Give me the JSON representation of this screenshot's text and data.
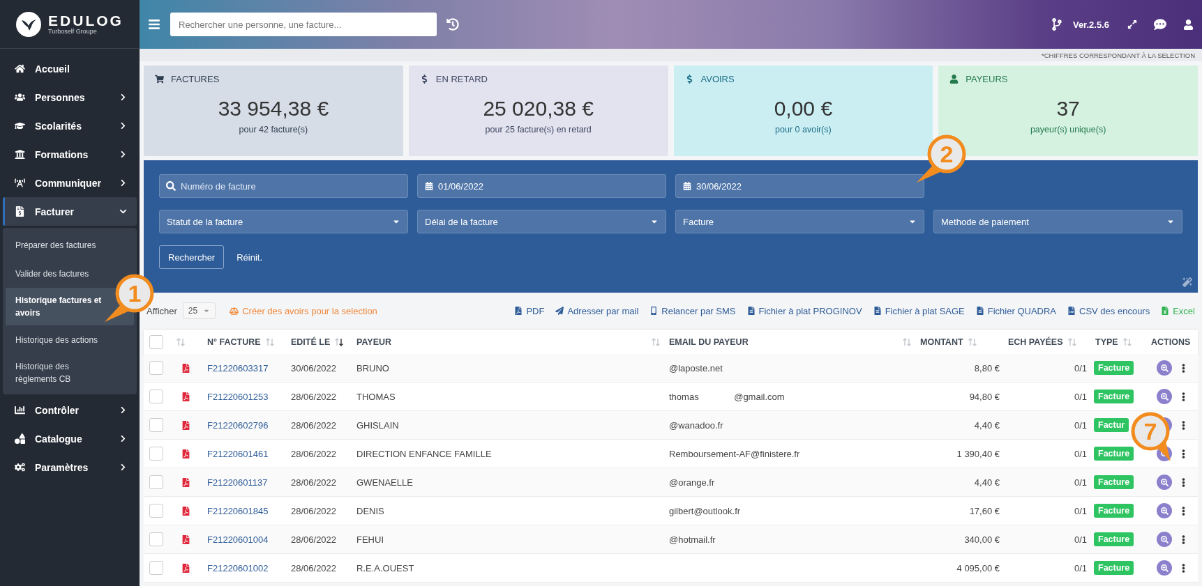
{
  "brand": {
    "name": "EDULOG",
    "tagline": "Turboself Groupe"
  },
  "sidebar": {
    "items": [
      {
        "label": "Accueil"
      },
      {
        "label": "Personnes",
        "expanded": false
      },
      {
        "label": "Scolarités",
        "expanded": false
      },
      {
        "label": "Formations",
        "expanded": false
      },
      {
        "label": "Communiquer",
        "expanded": false
      },
      {
        "label": "Facturer",
        "expanded": true,
        "children": [
          {
            "label": "Préparer des factures",
            "selected": false
          },
          {
            "label": "Valider des factures",
            "selected": false
          },
          {
            "label": "Historique factures et avoirs",
            "selected": true
          },
          {
            "label": "Historique des actions",
            "selected": false
          },
          {
            "label": "Historique des règlements CB",
            "selected": false
          }
        ]
      },
      {
        "label": "Contrôler",
        "expanded": false
      },
      {
        "label": "Catalogue",
        "expanded": false
      },
      {
        "label": "Paramètres",
        "expanded": false
      }
    ]
  },
  "header": {
    "search": {
      "placeholder": "Rechercher une personne, une facture..."
    },
    "version": "Ver.2.5.6"
  },
  "note": "*CHIFFRES CORRESPONDANT À LA SELECTION",
  "stats": [
    {
      "kind": "invoices",
      "title": "FACTURES",
      "value": "33 954,38 €",
      "caption": "pour 42 facture(s)"
    },
    {
      "kind": "late",
      "title": "EN RETARD",
      "value": "25 020,38 €",
      "caption": "pour 25 facture(s) en retard"
    },
    {
      "kind": "credits",
      "title": "AVOIRS",
      "value": "0,00 €",
      "caption": "pour 0 avoir(s)"
    },
    {
      "kind": "payers",
      "title": "PAYEURS",
      "value": "37",
      "caption": "payeur(s) unique(s)"
    }
  ],
  "filters": {
    "fields": [
      {
        "kind": "search",
        "placeholder": "Numéro de facture"
      },
      {
        "kind": "date",
        "value": "01/06/2022"
      },
      {
        "kind": "date",
        "value": "30/06/2022"
      },
      {
        "kind": "select",
        "value": "Statut de la facture"
      },
      {
        "kind": "select",
        "value": "Délai de la facture"
      },
      {
        "kind": "select",
        "value": "Facture"
      },
      {
        "kind": "select",
        "value": "Methode de paiement"
      }
    ],
    "search_button": "Rechercher",
    "reset_button": "Réinit."
  },
  "toolbar": {
    "page_size_label": "Afficher",
    "page_size": "25",
    "create_credits": "Créer des avoirs pour la selection",
    "exports": [
      {
        "kind": "pdf",
        "label": "PDF"
      },
      {
        "kind": "mail",
        "label": "Adresser par mail"
      },
      {
        "kind": "sms",
        "label": "Relancer par SMS"
      },
      {
        "kind": "file",
        "label": "Fichier à plat PROGINOV"
      },
      {
        "kind": "file",
        "label": "Fichier à plat SAGE"
      },
      {
        "kind": "file",
        "label": "Fichier QUADRA"
      },
      {
        "kind": "csv",
        "label": "CSV des encours"
      },
      {
        "kind": "excel",
        "label": "Excel"
      }
    ]
  },
  "table": {
    "select_all": {
      "checked": false
    },
    "columns": [
      {
        "kind": "check"
      },
      {
        "kind": "icon",
        "sortable": true,
        "sorted_desc": false
      },
      {
        "kind": "text",
        "label": "N° FACTURE",
        "sortable": true,
        "sorted_desc": false
      },
      {
        "kind": "text",
        "label": "EDITÉ LE",
        "sortable": true,
        "sorted_desc": true
      },
      {
        "kind": "text",
        "label": "PAYEUR",
        "sortable": true,
        "sorted_desc": false
      },
      {
        "kind": "text",
        "label": "EMAIL DU PAYEUR",
        "sortable": true,
        "sorted_desc": false
      },
      {
        "kind": "text",
        "label": "MONTANT",
        "sortable": true,
        "sorted_desc": false
      },
      {
        "kind": "text",
        "label": "ECH PAYÉES",
        "sortable": true,
        "sorted_desc": false
      },
      {
        "kind": "text",
        "label": "TYPE",
        "sortable": true,
        "sorted_desc": false
      },
      {
        "kind": "text",
        "label": "ACTIONS"
      }
    ],
    "rows": [
      {
        "checked": false,
        "number": "F21220603317",
        "date": "30/06/2022",
        "payer": "BRUNO",
        "email": "@laposte.net",
        "amount": "8,80 €",
        "paid": "0/1",
        "type": "Facture"
      },
      {
        "checked": false,
        "number": "F21220601253",
        "date": "28/06/2022",
        "payer": "THOMAS",
        "email": "thomas              @gmail.com",
        "amount": "94,80 €",
        "paid": "0/1",
        "type": "Facture"
      },
      {
        "checked": false,
        "number": "F21220602796",
        "date": "28/06/2022",
        "payer": "GHISLAIN",
        "email": "@wanadoo.fr",
        "amount": "4,40 €",
        "paid": "0/1",
        "type": "Factur"
      },
      {
        "checked": false,
        "number": "F21220601461",
        "date": "28/06/2022",
        "payer": "DIRECTION ENFANCE FAMILLE",
        "email": "Remboursement-AF@finistere.fr",
        "amount": "1 390,40 €",
        "paid": "0/1",
        "type": "Facture"
      },
      {
        "checked": false,
        "number": "F21220601137",
        "date": "28/06/2022",
        "payer": "GWENAELLE",
        "email": "@orange.fr",
        "amount": "4,40 €",
        "paid": "0/1",
        "type": "Facture"
      },
      {
        "checked": false,
        "number": "F21220601845",
        "date": "28/06/2022",
        "payer": "DENIS",
        "email": "gilbert@outlook.fr",
        "amount": "17,60 €",
        "paid": "0/1",
        "type": "Facture"
      },
      {
        "checked": false,
        "number": "F21220601004",
        "date": "28/06/2022",
        "payer": "FEHUI",
        "email": "@hotmail.fr",
        "amount": "340,00 €",
        "paid": "0/1",
        "type": "Facture"
      },
      {
        "checked": false,
        "number": "F21220601002",
        "date": "28/06/2022",
        "payer": "R.E.A.OUEST",
        "amount": "4 095,00 €",
        "paid": "0/1",
        "type": "Facture"
      }
    ]
  },
  "callouts": [
    {
      "label": "1"
    },
    {
      "label": "2"
    },
    {
      "label": "7"
    }
  ]
}
